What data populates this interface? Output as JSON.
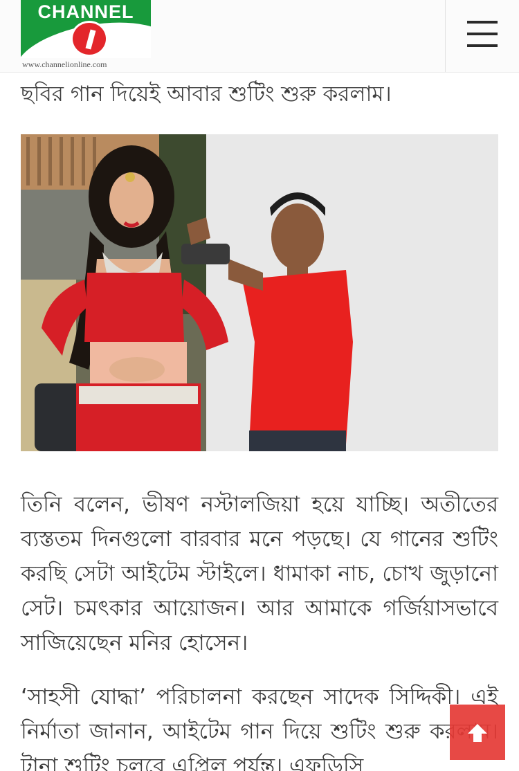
{
  "header": {
    "logo_word": "CHANNEL",
    "logo_url": "www.channelionline.com",
    "menu_icon": "hamburger-menu-icon"
  },
  "article": {
    "lead": "ছবির গান দিয়েই আবার শুটিং শুরু করলাম।",
    "paragraphs": [
      "তিনি বলেন, ভীষণ নস্টালজিয়া হয়ে যাচ্ছি। অতীতের ব্যস্ততম দিনগুলো বারবার মনে পড়ছে। যে গানের শুটিং করছি সেটা আইটেম স্টাইলে। ধামাকা নাচ, চোখ জুড়ানো সেট। চমৎকার আয়োজন। আর আমাকে গর্জিয়াসভাবে সাজিয়েছেন মনির হোসেন।",
      "‘সাহসী যোদ্ধা’ পরিচালনা করছেন সাদেক সিদ্দিকী। এই নির্মাতা জানান, আইটেম গান দিয়ে শুটিং শুরু করলাম। টানা শুটিং চলবে এপ্রিল পর্যন্ত। এফডিসি"
    ]
  },
  "scroll_top": {
    "icon": "arrow-up-icon",
    "color": "#e53935"
  },
  "colors": {
    "logo_green": "#189a3c",
    "logo_red": "#e3262b",
    "text": "#3a3a3a"
  }
}
